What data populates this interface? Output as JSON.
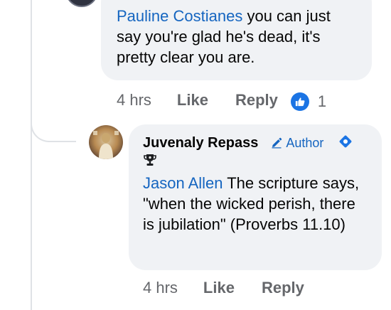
{
  "comment_1": {
    "mention": "Pauline Costianes",
    "text": " you can just say you're glad he's dead, it's pretty clear you are.",
    "time": "4 hrs",
    "like_label": "Like",
    "reply_label": "Reply",
    "reaction_icon": "thumbs-up-icon",
    "reaction_count": "1"
  },
  "comment_2": {
    "author": "Juvenaly Repass",
    "author_tag": "Author",
    "badge_icon": "trophy-icon",
    "mention": "Jason Allen",
    "text": " The scripture says, \"when the wicked perish, there is jubilation\" (Proverbs 11.10)",
    "time": "4 hrs",
    "like_label": "Like",
    "reply_label": "Reply"
  },
  "colors": {
    "bubble": "#f0f2f5",
    "link": "#1565c0",
    "meta": "#65676b",
    "reaction": "#1b74e4"
  }
}
